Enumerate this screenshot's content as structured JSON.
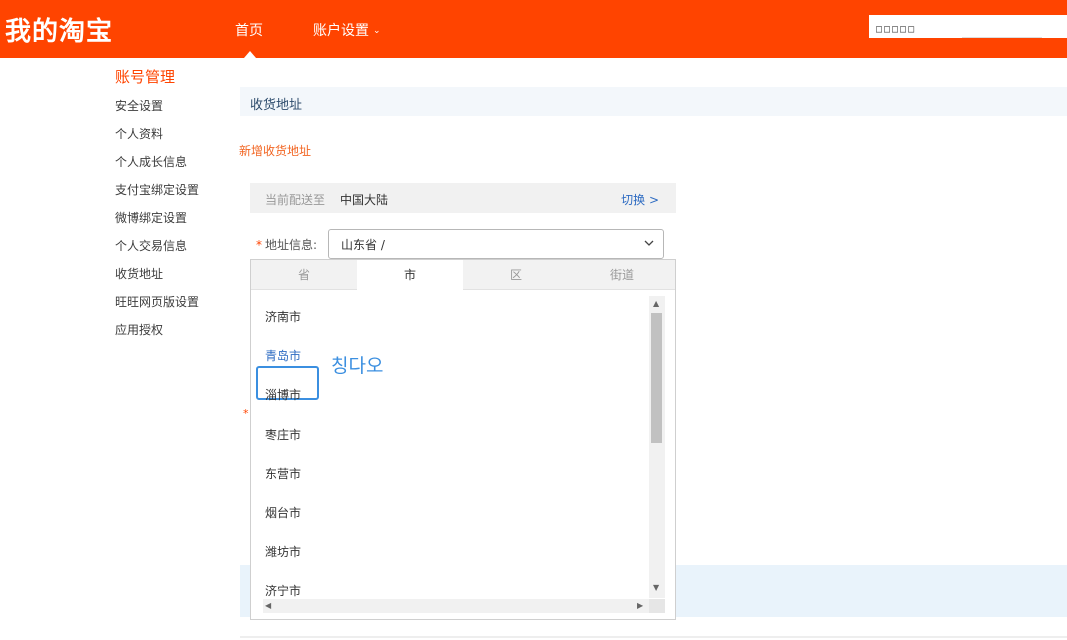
{
  "header": {
    "logo": "我的淘宝",
    "nav": {
      "home": "首页",
      "account_settings": "账户设置"
    },
    "search": {
      "placeholder": "□□□□□"
    }
  },
  "sidebar": {
    "title": "账号管理",
    "items": [
      {
        "label": "安全设置"
      },
      {
        "label": "个人资料"
      },
      {
        "label": "个人成长信息"
      },
      {
        "label": "支付宝绑定设置"
      },
      {
        "label": "微博绑定设置"
      },
      {
        "label": "个人交易信息"
      },
      {
        "label": "收货地址"
      },
      {
        "label": "旺旺网页版设置"
      },
      {
        "label": "应用授权"
      }
    ]
  },
  "main": {
    "section_title": "收货地址",
    "new_address": "新增收货地址",
    "deliver_label": "当前配送至",
    "deliver_value": "中国大陆",
    "switch_label": "切换 >",
    "address_label": "地址信息:",
    "required_mark": "*",
    "address_value": "山东省 /",
    "dropdown": {
      "tabs": [
        {
          "label": "省"
        },
        {
          "label": "市"
        },
        {
          "label": "区"
        },
        {
          "label": "街道"
        }
      ],
      "active_tab": "市",
      "cities": [
        {
          "label": "济南市"
        },
        {
          "label": "青岛市"
        },
        {
          "label": "淄博市"
        },
        {
          "label": "枣庄市"
        },
        {
          "label": "东营市"
        },
        {
          "label": "烟台市"
        },
        {
          "label": "潍坊市"
        },
        {
          "label": "济宁市"
        }
      ],
      "selected_city": "青岛市",
      "scroll_arrows": {
        "up": "▲",
        "down": "▼",
        "left": "◀",
        "right": "▶"
      }
    }
  },
  "overlay_text": "칭다오",
  "colors": {
    "brand": "#ff4400",
    "link": "#2d6bc2",
    "highlight": "#3b8fe0"
  }
}
